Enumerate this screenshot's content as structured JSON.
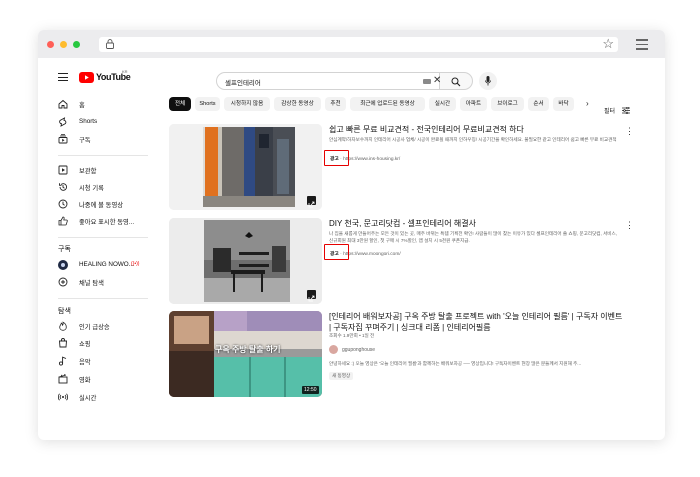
{
  "brand": {
    "name": "YouTube",
    "region": "KR"
  },
  "search": {
    "query": "셀프인테리어"
  },
  "sidebar": {
    "main": [
      {
        "label": "홈",
        "icon": "home-icon"
      },
      {
        "label": "Shorts",
        "icon": "shorts-icon"
      },
      {
        "label": "구독",
        "icon": "subscriptions-icon"
      }
    ],
    "library": [
      {
        "label": "보관함",
        "icon": "library-icon"
      },
      {
        "label": "시청 기록",
        "icon": "history-icon"
      },
      {
        "label": "나중에 볼 동영상",
        "icon": "watch-later-icon"
      },
      {
        "label": "좋아요 표시한 동영...",
        "icon": "thumbs-up-icon"
      }
    ],
    "subs_heading": "구독",
    "subs": [
      {
        "label": "HEALING NOWO...",
        "icon": "channel-avatar-icon",
        "live": "((•))"
      },
      {
        "label": "채널 탐색",
        "icon": "add-channel-icon"
      }
    ],
    "explore_heading": "탐색",
    "explore": [
      {
        "label": "인기 급상승",
        "icon": "trending-icon"
      },
      {
        "label": "쇼핑",
        "icon": "shopping-icon"
      },
      {
        "label": "음악",
        "icon": "music-icon"
      },
      {
        "label": "영화",
        "icon": "movie-icon"
      },
      {
        "label": "실시간",
        "icon": "live-icon"
      }
    ]
  },
  "chips": [
    "전체",
    "Shorts",
    "시청하지 않음",
    "감상한 동영상",
    "추천",
    "최근에 업로드된 동영상",
    "실시간",
    "아파트",
    "브이로그",
    "순서",
    "바닥"
  ],
  "filter_label": "필터",
  "results": [
    {
      "title": "쉽고 빠른 무료 비교견적 - 전국인테리어 무료비교견적 하다",
      "description": "안심계약/하자보수까지 인테리어 시공사 업체/ 시공이 완료될 때까지 인하우징/ 시공기간을 확인하세요. 불필요한 같고 인테리어 쉽고 빠른 무료 비교견적",
      "ad_label": "광고",
      "url": "https://www.ins-housing.kr/"
    },
    {
      "title": "DIY 천국, 문고리닷컴 - 셀프인테리어 해결사",
      "description": "나 집을 새롭게 만들어주는 모든 것이 있는 곳, 매주 바뀌는 특템 기획전 확인! 사람들이 많이 찾는 이유가 있다 셀프인테리어 쏠 쇼핑, 문고리닷컴, 서비스, 신규회원 최대 3만원 할인, 첫 구매 시 7%할인, 앱 설치 시 5천원 쿠폰지급.",
      "ad_label": "광고",
      "url": "https://www.moongori.com/"
    },
    {
      "title": "[인테리어 배워보자공] 구옥 주방 탈출 프로젝트 with '오늘 인테리어 필름' | 구독자 이벤트 | 구독자집 꾸며주기 | 싱크대 리폼 | 인테리어필름",
      "meta": "조회수 1.9만회 • 1일 전",
      "channel": "gguponghouse",
      "description": "안녕하세요 :) 오늘 영상은 '오늘 인테리어 필름'과 함께하는 배워보자공 ── 영상입니다! 구독자이벤트 현장 많은 분들께서 지원해 주...",
      "badge": "새 동영상",
      "duration": "12:50",
      "overlay": "구옥 주방 탈출 하기"
    }
  ]
}
